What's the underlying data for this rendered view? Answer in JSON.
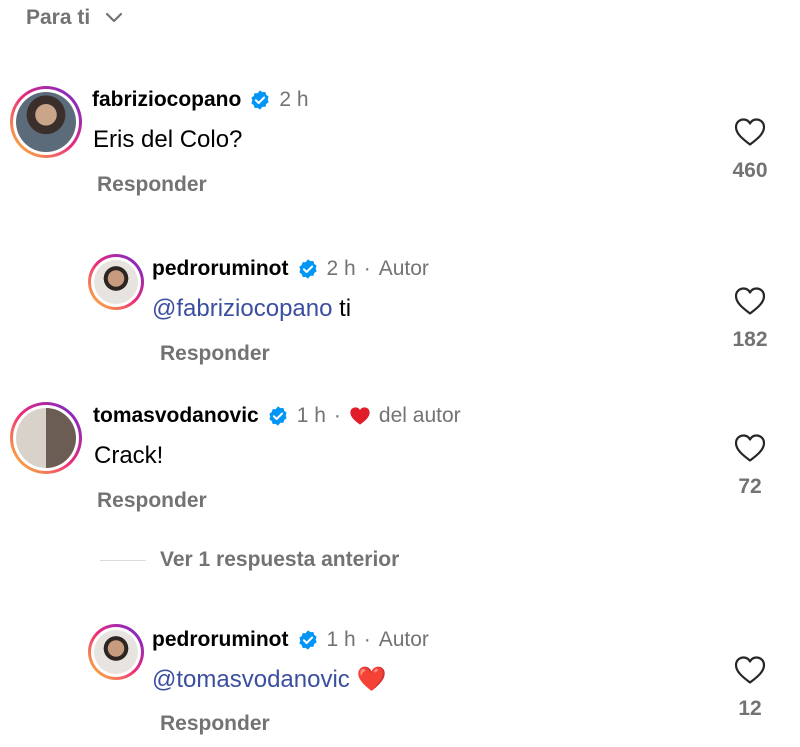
{
  "header": {
    "sort_label": "Para ti"
  },
  "colors": {
    "verified": "#0095f6",
    "mention": "#3b4fa0",
    "secondary": "#737373",
    "author_heart": "#e11d2a"
  },
  "comments": [
    {
      "username": "fabriziocopano",
      "time": "2 h",
      "text": "Eris del Colo?",
      "reply_label": "Responder",
      "likes": "460"
    },
    {
      "username": "pedroruminot",
      "time": "2 h",
      "sep": "·",
      "badge": "Autor",
      "mention": "@fabriziocopano",
      "text": " ti",
      "reply_label": "Responder",
      "likes": "182"
    },
    {
      "username": "tomasvodanovic",
      "time": "1 h",
      "sep": "·",
      "author_like": "del autor",
      "text": "Crack!",
      "reply_label": "Responder",
      "likes": "72"
    },
    {
      "username": "pedroruminot",
      "time": "1 h",
      "sep": "·",
      "badge": "Autor",
      "mention": "@tomasvodanovic",
      "text": " ❤️",
      "reply_label": "Responder",
      "likes": "12"
    }
  ],
  "view_replies": "Ver 1 respuesta anterior"
}
